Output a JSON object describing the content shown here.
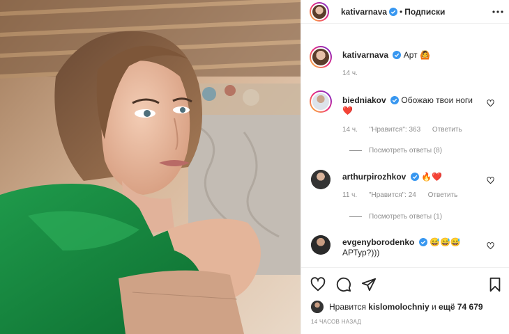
{
  "header": {
    "username": "kativarnava",
    "separator": "•",
    "follow_label": "Подписки",
    "more_icon": "more-horizontal-icon"
  },
  "caption": {
    "username": "kativarnava",
    "text": "Арт",
    "emoji": "🙆",
    "time": "14 ч."
  },
  "comments": [
    {
      "username": "biedniakov",
      "verified": true,
      "text": "Обожаю твои ноги",
      "emoji": "❤️",
      "time": "14 ч.",
      "likes": "\"Нравится\": 363",
      "reply_label": "Ответить",
      "view_replies": "Посмотреть ответы (8)"
    },
    {
      "username": "arthurpirozhkov",
      "verified": true,
      "text": "",
      "emoji": "🔥❤️",
      "time": "11 ч.",
      "likes": "\"Нравится\": 24",
      "reply_label": "Ответить",
      "view_replies": "Посмотреть ответы (1)"
    },
    {
      "username": "evgenyborodenko",
      "verified": true,
      "text": "",
      "emoji": "😅😅😅",
      "text2": "АРТур?)))"
    }
  ],
  "likes_bar": {
    "prefix": "Нравится",
    "user": "kislomolochniy",
    "suffix": "и",
    "count": "ещё 74 679"
  },
  "time_ago": "14 ЧАСОВ НАЗАД",
  "colors": {
    "verified_blue": "#3897f0",
    "heart_red": "#ed4956",
    "muted_gray": "#8e8e8e",
    "text": "#262626"
  }
}
